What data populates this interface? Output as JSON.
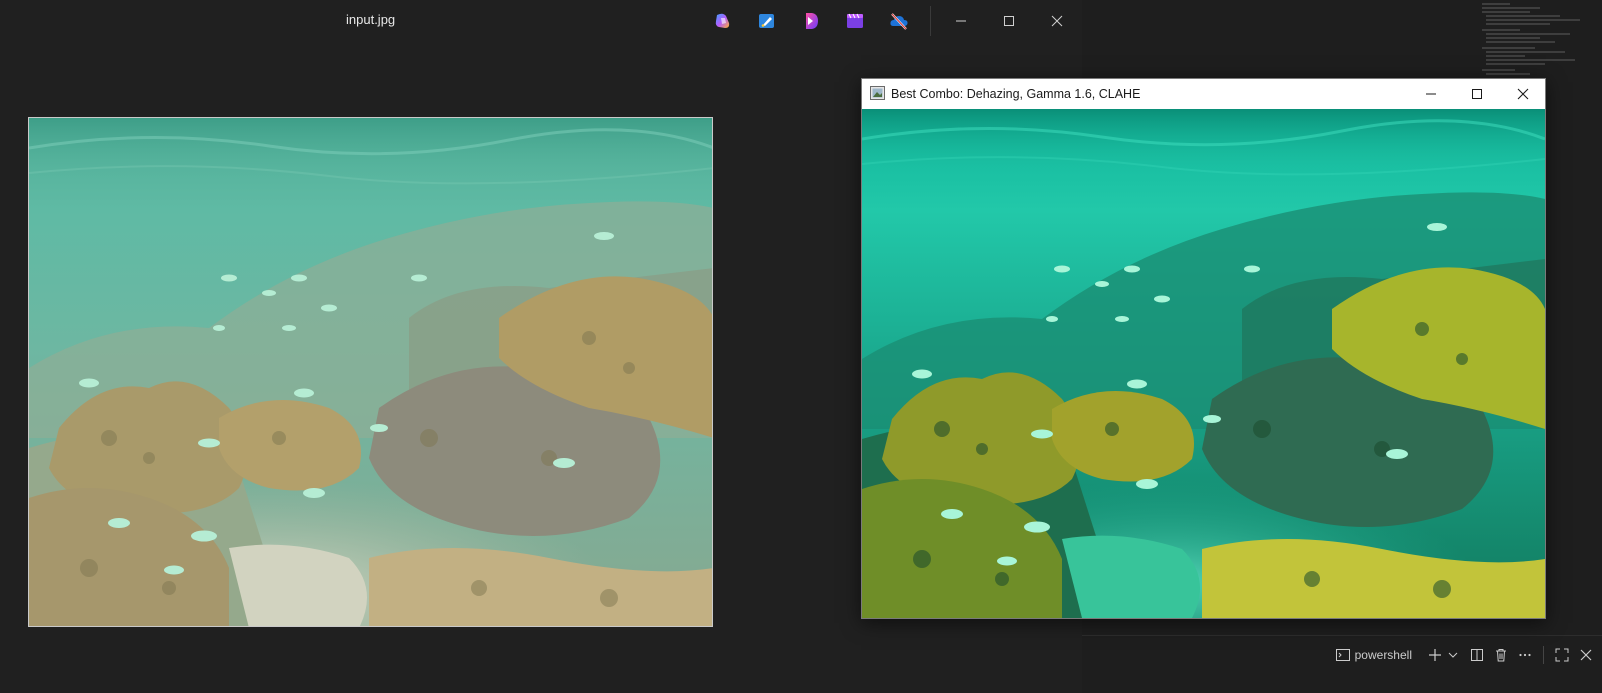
{
  "photos": {
    "title": "input.jpg",
    "taskbar_icons": [
      "copilot-icon",
      "paint-icon",
      "clipchamp-icon",
      "video-editor-icon",
      "onedrive-offline-icon"
    ],
    "controls": [
      "minimize-icon",
      "maximize-icon",
      "close-icon"
    ]
  },
  "cv_window": {
    "title": "Best Combo: Dehazing, Gamma 1.6, CLAHE",
    "controls": [
      "minimize-icon",
      "maximize-icon",
      "close-icon"
    ]
  },
  "terminal": {
    "shell_label": "powershell",
    "actions": [
      "new-terminal-icon",
      "chevron-down-icon",
      "split-terminal-icon",
      "trash-icon",
      "more-icon",
      "maximize-panel-icon",
      "close-icon"
    ]
  },
  "colors": {
    "window_bg": "#202020",
    "editor_bg": "#1e1e1e",
    "water_original": "#5fb8a0",
    "water_enhanced": "#1fc9a8",
    "coral_original": "#a79a6e",
    "coral_enhanced": "#b7c93a"
  }
}
